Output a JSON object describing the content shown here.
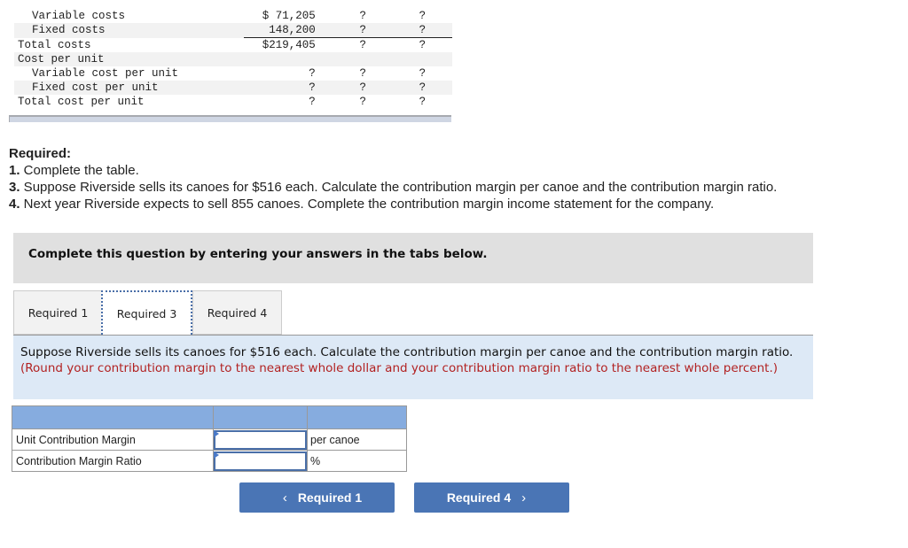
{
  "cost_table": {
    "rows": [
      {
        "label": "Variable costs",
        "indent": true,
        "alt": false,
        "v1": "$ 71,205",
        "v2": "?",
        "v3": "?",
        "underline": false
      },
      {
        "label": "Fixed costs",
        "indent": true,
        "alt": true,
        "v1": "148,200",
        "v2": "?",
        "v3": "?",
        "underline": true
      },
      {
        "label": "Total costs",
        "indent": false,
        "alt": false,
        "v1": "$219,405",
        "v2": "?",
        "v3": "?",
        "underline": false
      },
      {
        "label": "Cost per unit",
        "indent": false,
        "alt": true,
        "v1": "",
        "v2": "",
        "v3": "",
        "underline": false
      },
      {
        "label": "Variable cost per unit",
        "indent": true,
        "alt": false,
        "v1": "?",
        "v2": "?",
        "v3": "?",
        "underline": false
      },
      {
        "label": "Fixed cost per unit",
        "indent": true,
        "alt": true,
        "v1": "?",
        "v2": "?",
        "v3": "?",
        "underline": false
      },
      {
        "label": "Total cost per unit",
        "indent": false,
        "alt": false,
        "v1": "?",
        "v2": "?",
        "v3": "?",
        "underline": false
      }
    ]
  },
  "required": {
    "heading": "Required:",
    "items": [
      {
        "num": "1.",
        "text": " Complete the table."
      },
      {
        "num": "3.",
        "text": " Suppose Riverside sells its canoes for $516 each. Calculate the contribution margin per canoe and the contribution margin ratio."
      },
      {
        "num": "4.",
        "text": " Next year Riverside expects to sell 855 canoes. Complete the contribution margin income statement for the company."
      }
    ]
  },
  "instruction": "Complete this question by entering your answers in the tabs below.",
  "tabs": [
    {
      "label": "Required 1",
      "active": false
    },
    {
      "label": "Required 3",
      "active": true
    },
    {
      "label": "Required 4",
      "active": false
    }
  ],
  "question": {
    "text": "Suppose Riverside sells its canoes for $516 each. Calculate the contribution margin per canoe and the contribution margin ratio. ",
    "note": "(Round your contribution margin to the nearest whole dollar and your contribution margin ratio to the nearest whole percent.)"
  },
  "answer_table": {
    "rows": [
      {
        "label": "Unit Contribution Margin",
        "value": "",
        "unit": "per canoe"
      },
      {
        "label": "Contribution Margin Ratio",
        "value": "",
        "unit": "%"
      }
    ]
  },
  "nav": {
    "prev_label": "Required 1",
    "next_label": "Required 4",
    "prev_icon": "chevron-left-icon",
    "next_icon": "chevron-right-icon"
  },
  "colors": {
    "accent": "#4a75b5",
    "table_header": "#86acdf",
    "question_bg": "#dde9f6",
    "note_red": "#b22222"
  }
}
